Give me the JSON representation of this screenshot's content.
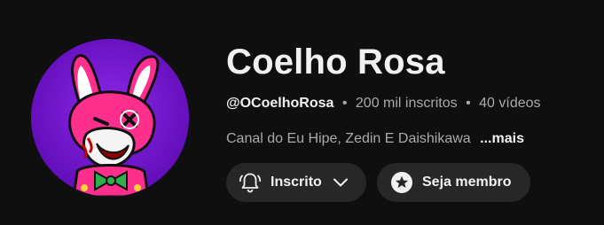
{
  "channel": {
    "name": "Coelho Rosa",
    "handle": "@OCoelhoRosa",
    "subscribers": "200 mil inscritos",
    "videos": "40 vídeos",
    "separator": "•",
    "description": "Canal do Eu Hipe, Zedin E Daishikawa",
    "more_label": "...mais"
  },
  "actions": {
    "subscribe_label": "Inscrito",
    "member_label": "Seja membro"
  },
  "icons": {
    "subscribe": "bell-icon",
    "dropdown": "chevron-down-icon",
    "member": "star-badge-icon"
  },
  "colors": {
    "background": "#0f0f0f",
    "button_bg": "#272727",
    "text_primary": "#f1f1f1",
    "text_secondary": "#aaaaaa",
    "avatar_bg": "#7a16d6"
  }
}
